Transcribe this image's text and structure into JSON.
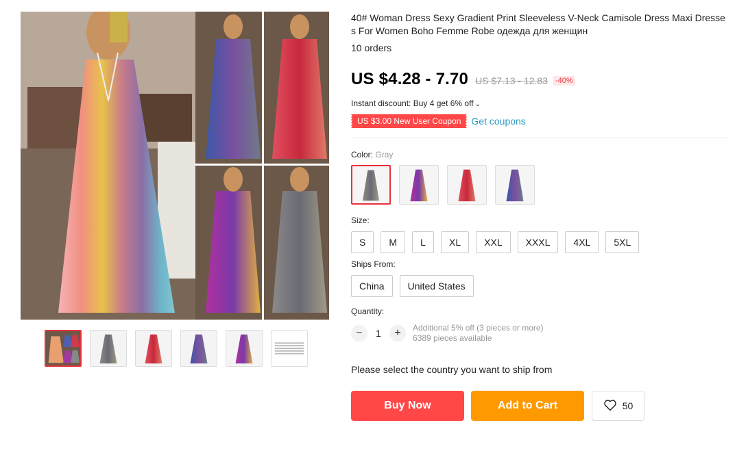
{
  "gallery": {
    "thumbnails": [
      {
        "name": "collage"
      },
      {
        "name": "gray"
      },
      {
        "name": "red"
      },
      {
        "name": "blue-purple"
      },
      {
        "name": "purple"
      },
      {
        "name": "size-chart"
      }
    ]
  },
  "product": {
    "title": "40# Woman Dress Sexy Gradient Print Sleeveless V-Neck Camisole Dress Maxi Dresses For Women Boho Femme Robe одежда для женщин",
    "orders": "10 orders",
    "price": "US $4.28 - 7.70",
    "original_price": "US $7.13 - 12.83",
    "discount": "-40%",
    "instant_discount": "Instant discount: Buy 4 get 6% off",
    "coupon": "US $3.00 New User Coupon",
    "get_coupons": "Get coupons"
  },
  "color": {
    "label": "Color:",
    "selected": "Gray",
    "options": [
      {
        "name": "gray"
      },
      {
        "name": "purple"
      },
      {
        "name": "red"
      },
      {
        "name": "blue-purple"
      }
    ]
  },
  "size": {
    "label": "Size:",
    "options": [
      "S",
      "M",
      "L",
      "XL",
      "XXL",
      "XXXL",
      "4XL",
      "5XL"
    ]
  },
  "ships_from": {
    "label": "Ships From:",
    "options": [
      "China",
      "United States"
    ]
  },
  "quantity": {
    "label": "Quantity:",
    "value": "1",
    "minus": "−",
    "plus": "+",
    "note1": "Additional 5% off (3 pieces or more)",
    "note2": "6389 pieces available"
  },
  "ship_message": "Please select the country you want to ship from",
  "buttons": {
    "buy_now": "Buy Now",
    "add_to_cart": "Add to Cart",
    "wishlist_count": "50"
  },
  "colors": {
    "accent_red": "#ff4747",
    "accent_orange": "#ff9900",
    "link_blue": "#2e9cc3"
  }
}
